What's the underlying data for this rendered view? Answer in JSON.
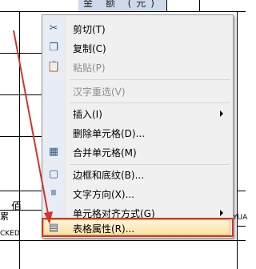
{
  "document": {
    "header_cell_text": "金 额 (元)",
    "cell_bai": "佰",
    "cell_cked": "CKED",
    "cell_yua": "YUA",
    "cell_bottom_left": "累"
  },
  "context_menu": {
    "items": [
      {
        "label": "剪切(T)",
        "icon": "scissors-icon",
        "disabled": false
      },
      {
        "label": "复制(C)",
        "icon": "copy-icon",
        "disabled": false
      },
      {
        "label": "粘贴(P)",
        "icon": "paste-icon",
        "disabled": true
      },
      {
        "label": "汉字重选(V)",
        "icon": "",
        "disabled": true
      },
      {
        "label": "插入(I)",
        "icon": "",
        "disabled": false,
        "submenu": true
      },
      {
        "label": "删除单元格(D)...",
        "icon": "",
        "disabled": false
      },
      {
        "label": "合并单元格(M)",
        "icon": "merge-cells-icon",
        "disabled": false
      },
      {
        "label": "边框和底纹(B)...",
        "icon": "borders-icon",
        "disabled": false
      },
      {
        "label": "文字方向(X)...",
        "icon": "text-direction-icon",
        "disabled": false
      },
      {
        "label": "单元格对齐方式(G)",
        "icon": "",
        "disabled": false,
        "submenu": true
      },
      {
        "label": "自动调整(A)",
        "icon": "",
        "disabled": false,
        "submenu": true
      },
      {
        "label": "表格属性(R)...",
        "icon": "table-properties-icon",
        "disabled": false,
        "highlighted": true
      }
    ]
  },
  "colors": {
    "highlight_border": "#e9bb55",
    "annotation_red": "#d0342c"
  }
}
